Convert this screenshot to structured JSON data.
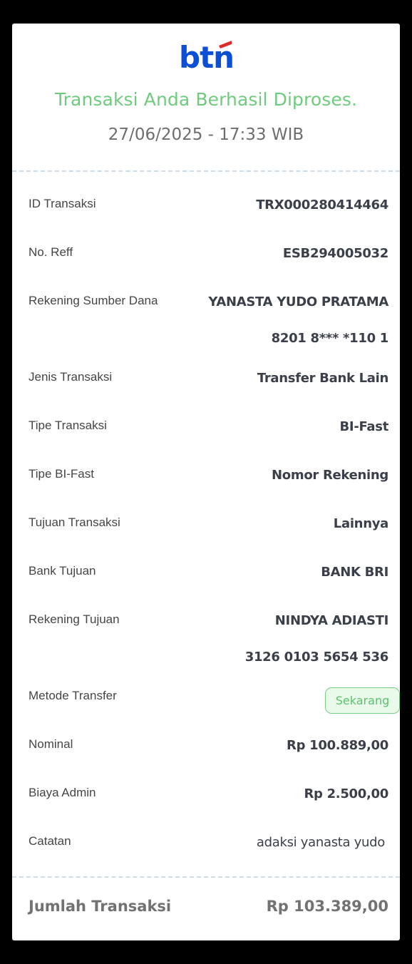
{
  "brand": {
    "logo_text": "btn",
    "logo_color": "#0a4fd6",
    "logo_accent": "#e02a2a"
  },
  "status": {
    "message": "Transaksi Anda Berhasil Diproses.",
    "datetime": "27/06/2025 - 17:33 WIB",
    "success_color": "#6fcb7d"
  },
  "details": {
    "id_transaksi": {
      "label": "ID Transaksi",
      "value": "TRX000280414464"
    },
    "no_reff": {
      "label": "No. Reff",
      "value": "ESB294005032"
    },
    "rekening_sumber": {
      "label": "Rekening Sumber Dana",
      "name": "YANASTA YUDO PRATAMA",
      "number": "8201 8*** *110 1"
    },
    "jenis_transaksi": {
      "label": "Jenis Transaksi",
      "value": "Transfer Bank Lain"
    },
    "tipe_transaksi": {
      "label": "Tipe Transaksi",
      "value": "BI-Fast"
    },
    "tipe_bifast": {
      "label": "Tipe BI-Fast",
      "value": "Nomor Rekening"
    },
    "tujuan_transaksi": {
      "label": "Tujuan Transaksi",
      "value": "Lainnya"
    },
    "bank_tujuan": {
      "label": "Bank Tujuan",
      "value": "BANK BRI"
    },
    "rekening_tujuan": {
      "label": "Rekening Tujuan",
      "name": "NINDYA ADIASTI",
      "number": "3126 0103 5654 536"
    },
    "metode_transfer": {
      "label": "Metode Transfer",
      "value": "Sekarang"
    },
    "nominal": {
      "label": "Nominal",
      "value": "Rp 100.889,00"
    },
    "biaya_admin": {
      "label": "Biaya Admin",
      "value": "Rp 2.500,00"
    },
    "catatan": {
      "label": "Catatan",
      "value": "adaksi yanasta yudo"
    }
  },
  "total": {
    "label": "Jumlah Transaksi",
    "value": "Rp 103.389,00"
  }
}
